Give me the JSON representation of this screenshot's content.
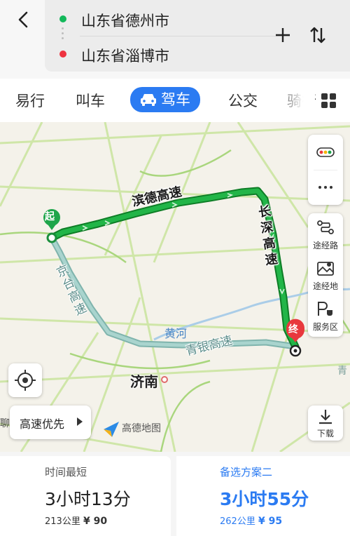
{
  "header": {
    "origin": "山东省德州市",
    "destination": "山东省淄博市",
    "origin_color": "#12b85a",
    "destination_color": "#ee3340"
  },
  "tabs": {
    "items": [
      "易行",
      "叫车",
      "驾车",
      "公交",
      "骑行"
    ],
    "active": "驾车",
    "active_color": "#2b7bf2"
  },
  "map": {
    "main_route_color": "#1aa33a",
    "alt_route_color": "#8fc5bf",
    "start_marker": "起",
    "end_marker": "终",
    "highways": [
      "滨德高速",
      "长深高速"
    ],
    "alt_roads": [
      "京台高速",
      "青银高速"
    ],
    "city": "济南",
    "river": "黄河",
    "edge_partial_left": "聊",
    "edge_partial_right": "青",
    "logo_text": "高德地图",
    "route_preference": "高速优先",
    "side_buttons": {
      "waypoint_road": "途经路",
      "waypoint_place": "途经地",
      "service_area": "服务区"
    },
    "download_label": "下载"
  },
  "routes": [
    {
      "tag": "时间最短",
      "duration": "3小时13分",
      "distance": "213公里",
      "toll": "¥ 90"
    },
    {
      "tag": "备选方案二",
      "duration": "3小时55分",
      "distance": "262公里",
      "toll": "¥ 95"
    }
  ]
}
